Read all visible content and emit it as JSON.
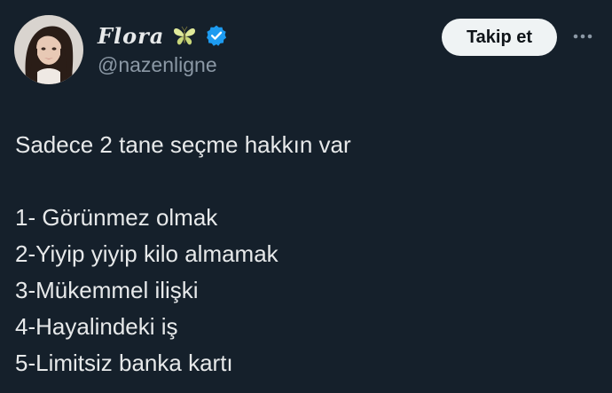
{
  "author": {
    "display_name": "Flora",
    "name_emoji": "butterfly-emoji",
    "verified": true,
    "verified_color": "#1d9bf0",
    "handle": "@nazenligne"
  },
  "actions": {
    "follow_label": "Takip et",
    "more_icon": "more-horizontal-icon"
  },
  "tweet": {
    "intro": "Sadece 2 tane seçme hakkın var",
    "options": [
      "1- Görünmez olmak",
      "2-Yiyip yiyip kilo almamak",
      "3-Mükemmel ilişki",
      "4-Hayalindeki iş",
      "5-Limitsiz banka kartı"
    ]
  },
  "colors": {
    "background": "#15202b",
    "text": "#e7e9ea",
    "secondary_text": "#8b98a5",
    "button_bg": "#eff3f4"
  }
}
